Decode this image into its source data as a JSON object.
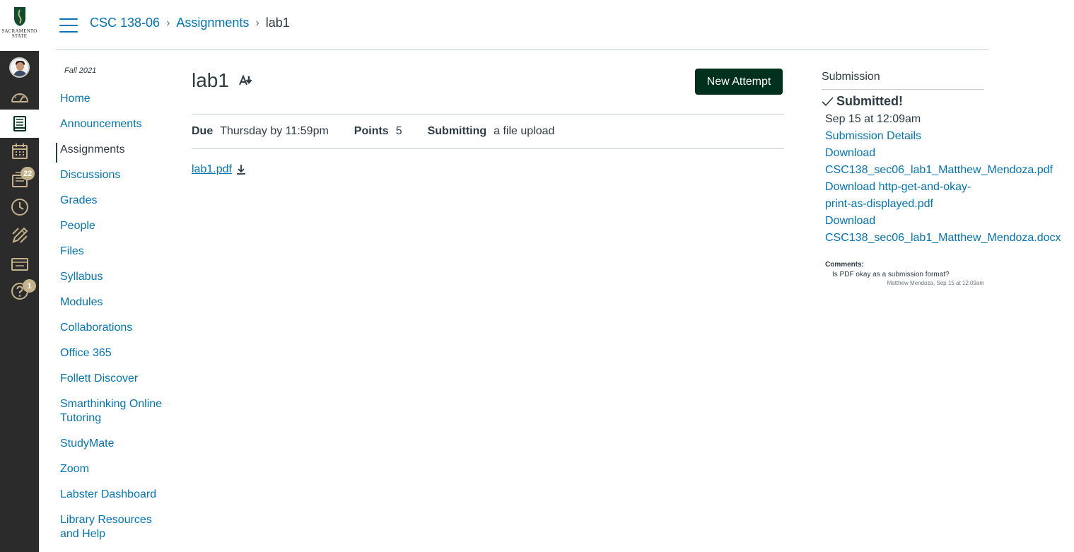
{
  "logo": {
    "text_line1": "SACRAMENTO",
    "text_line2": "STATE"
  },
  "global_nav": {
    "inbox_badge": "22",
    "help_badge": "1"
  },
  "breadcrumb": {
    "course": "CSC 138-06",
    "section": "Assignments",
    "current": "lab1"
  },
  "course_nav": {
    "term": "Fall 2021",
    "items": [
      {
        "label": "Home"
      },
      {
        "label": "Announcements"
      },
      {
        "label": "Assignments"
      },
      {
        "label": "Discussions"
      },
      {
        "label": "Grades"
      },
      {
        "label": "People"
      },
      {
        "label": "Files"
      },
      {
        "label": "Syllabus"
      },
      {
        "label": "Modules"
      },
      {
        "label": "Collaborations"
      },
      {
        "label": "Office 365"
      },
      {
        "label": "Follett Discover"
      },
      {
        "label": "Smarthinking Online Tutoring"
      },
      {
        "label": "StudyMate"
      },
      {
        "label": "Zoom"
      },
      {
        "label": "Labster Dashboard"
      },
      {
        "label": "Library Resources and Help"
      }
    ]
  },
  "assignment": {
    "title": "lab1",
    "new_attempt_label": "New Attempt",
    "due_label": "Due",
    "due_value": "Thursday by 11:59pm",
    "points_label": "Points",
    "points_value": "5",
    "submitting_label": "Submitting",
    "submitting_value": "a file upload",
    "attachment": "lab1.pdf"
  },
  "submission": {
    "heading": "Submission",
    "status": "Submitted!",
    "date": "Sep 15 at 12:09am",
    "details_link": "Submission Details",
    "download_word": "Download",
    "file1": "CSC138_sec06_lab1_Matthew_Mendoza.pdf",
    "file2_line1": "Download http-get-and-okay-",
    "file2_line2": "print-as-displayed.pdf",
    "file3": "CSC138_sec06_lab1_Matthew_Mendoza.docx",
    "comments_label": "Comments:",
    "comment_text": "Is PDF okay as a submission format?",
    "comment_meta": "Matthew Mendoza, Sep 15 at 12:09am"
  },
  "colors": {
    "link": "#0374b5",
    "text": "#2d3b45",
    "nav_bg": "#2b2b2b",
    "primary_button": "#00301e",
    "nav_icon": "#c4b28a"
  }
}
